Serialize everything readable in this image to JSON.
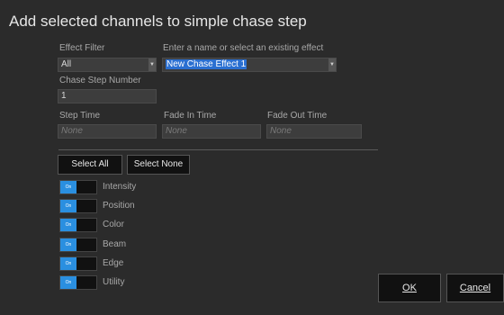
{
  "dialog": {
    "title": "Add selected channels to simple chase step"
  },
  "effect_filter": {
    "label": "Effect Filter",
    "value": "All"
  },
  "effect_name": {
    "label": "Enter a name or select an existing effect",
    "value": "New Chase Effect 1"
  },
  "chase_step": {
    "label": "Chase Step Number",
    "value": "1"
  },
  "step_time": {
    "label": "Step Time",
    "placeholder": "None"
  },
  "fade_in": {
    "label": "Fade In Time",
    "placeholder": "None"
  },
  "fade_out": {
    "label": "Fade Out Time",
    "placeholder": "None"
  },
  "buttons": {
    "select_all": "Select All",
    "select_none": "Select None",
    "ok": "OK",
    "cancel": "Cancel"
  },
  "toggles": [
    {
      "state": "On",
      "label": "Intensity"
    },
    {
      "state": "On",
      "label": "Position"
    },
    {
      "state": "On",
      "label": "Color"
    },
    {
      "state": "On",
      "label": "Beam"
    },
    {
      "state": "On",
      "label": "Edge"
    },
    {
      "state": "On",
      "label": "Utility"
    }
  ],
  "colors": {
    "accent": "#2a8fe0",
    "background": "#2b2b2b"
  }
}
